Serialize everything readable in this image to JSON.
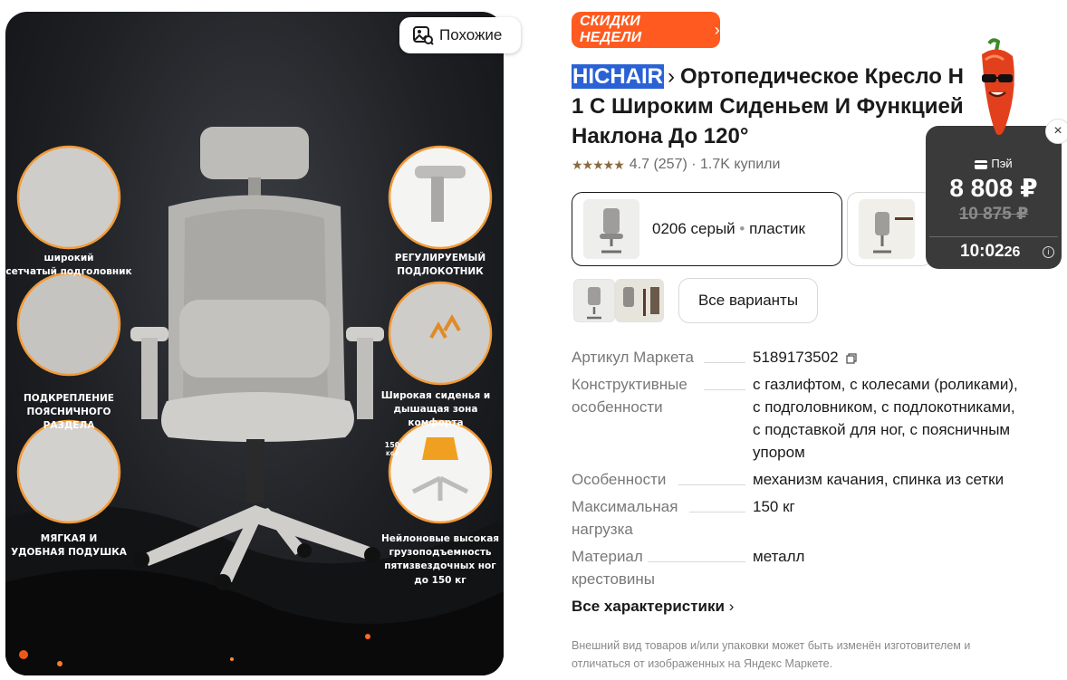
{
  "gallery": {
    "similar_label": "Похожие",
    "callouts": [
      {
        "line1": "широкий",
        "line2": "сетчатый подголовник"
      },
      {
        "line1": "ПОДКРЕПЛЕНИЕ",
        "line2": "ПОЯСНИЧНОГО РАЗДЕЛА"
      },
      {
        "line1": "МЯГКАЯ И",
        "line2": "УДОБНАЯ ПОДУШКА"
      },
      {
        "line1": "РЕГУЛИРУЕМЫЙ",
        "line2": "ПОДЛОКОТНИК"
      },
      {
        "line1": "Широкая сиденья и",
        "line2": "дышащая зона комфорта"
      },
      {
        "line1": "Нейлоновые высокая",
        "line2": "грузоподъемность",
        "line3": "пятизвездочных ног",
        "line4": "до 150 кг"
      }
    ],
    "weight_badge": "150",
    "weight_unit": "KGS"
  },
  "deal_badge": {
    "label": "СКИДКИ НЕДЕЛИ",
    "chevron": "›"
  },
  "product": {
    "brand": "HICHAIR",
    "brand_chevron": "›",
    "title_line1": "Ортопедическое Кресло H",
    "title_line2": "1 С Широким Сиденьем И Функцией",
    "title_line3": "Наклона До 120°",
    "rating_stars": "★★★★★",
    "rating_text": "4.7 (257) · 1.7K купили"
  },
  "variants": {
    "selected_color": "0206 серый",
    "selected_material": "пластик",
    "separator": "•",
    "all_variants_label": "Все варианты"
  },
  "specs": [
    {
      "key": "Артикул Маркета",
      "value": "5189173502"
    },
    {
      "key": "Конструктивные особенности",
      "value": "с газлифтом, с колесами (роликами), с подголовником, с подлокотниками, с подставкой для ног, с поясничным упором"
    },
    {
      "key": "Особенности",
      "value": "механизм качания, спинка из сетки"
    },
    {
      "key": "Максимальная нагрузка",
      "value": "150 кг"
    },
    {
      "key": "Материал крестовины",
      "value": "металл"
    }
  ],
  "all_specs_label": "Все характеристики",
  "all_specs_chevron": "›",
  "disclaimer": "Внешний вид товаров и/или упаковки может быть изменён изготовителем и отличаться от изображенных на Яндекс Маркете.",
  "promo": {
    "pay_label": "Пэй",
    "price": "8 808 ₽",
    "old_price": "10 875 ₽",
    "timer_main": "10:02",
    "timer_seconds": "26",
    "close": "×",
    "info": "i"
  },
  "colors": {
    "accent": "#ff5a1f",
    "brand_highlight": "#2a62d6",
    "promo_bg": "#3a3a3a",
    "muted": "#787878"
  },
  "icons": [
    "similar-image-icon",
    "chevron-right-icon",
    "copy-icon",
    "close-icon",
    "info-icon",
    "wallet-icon",
    "pepper-mascot-icon"
  ]
}
